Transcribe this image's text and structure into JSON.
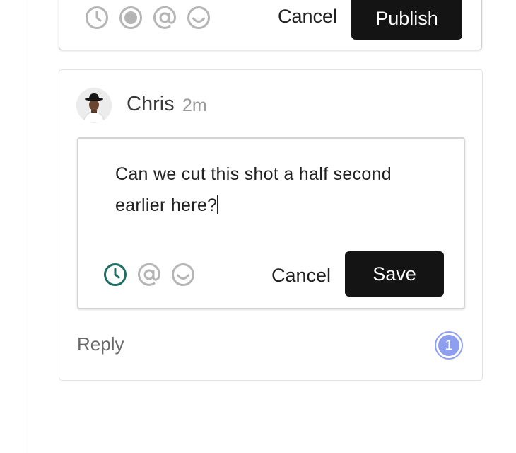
{
  "composer": {
    "tools": [
      {
        "name": "timestamp-icon",
        "color": "#b5b5b5"
      },
      {
        "name": "record-icon",
        "color": "#b5b5b5"
      },
      {
        "name": "mention-icon",
        "color": "#b5b5b5"
      },
      {
        "name": "emoji-icon",
        "color": "#b5b5b5"
      }
    ],
    "cancel_label": "Cancel",
    "publish_label": "Publish"
  },
  "comment": {
    "author": "Chris",
    "time_ago": "2m",
    "avatar_icon": "user-avatar",
    "edit": {
      "text": "Can we cut this shot a half second earlier here?",
      "tools": [
        {
          "name": "timestamp-icon",
          "color": "#1f6e62",
          "active": true
        },
        {
          "name": "mention-icon",
          "color": "#b5b5b5"
        },
        {
          "name": "emoji-icon",
          "color": "#b5b5b5"
        }
      ],
      "cancel_label": "Cancel",
      "save_label": "Save"
    },
    "reply_label": "Reply",
    "reply_count": "1",
    "badge_color": "#8f9ff0"
  }
}
